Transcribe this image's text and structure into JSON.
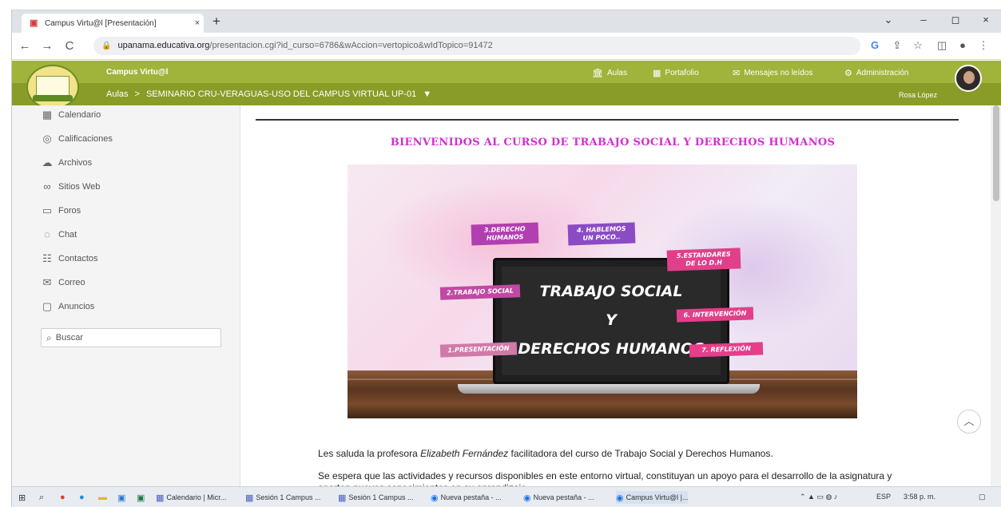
{
  "browser": {
    "tab_title": "Campus Virtu@l [Presentación]",
    "tab_close": "×",
    "new_tab": "+",
    "url_host": "upanama.educativa.org",
    "url_path": "/presentacion.cgi?id_curso=6786&wAccion=vertopico&wIdTopico=91472",
    "back": "←",
    "forward": "→",
    "reload": "C",
    "minimize": "–",
    "maximize": "◻",
    "close": "×",
    "chevron": "⌄"
  },
  "site": {
    "name": "Campus Virtu@l",
    "nav": [
      {
        "label": "Aulas",
        "icon": "building-icon"
      },
      {
        "label": "Portafolio",
        "icon": "portfolio-icon"
      },
      {
        "label": "Mensajes no leídos",
        "icon": "mail-icon"
      },
      {
        "label": "Administración",
        "icon": "gear-icon"
      }
    ],
    "breadcrumb_root": "Aulas",
    "breadcrumb_sep": ">",
    "breadcrumb_course": "SEMINARIO CRU-VERAGUAS-USO DEL CAMPUS VIRTUAL UP-01",
    "user": "Rosa López"
  },
  "sidebar": {
    "items": [
      {
        "label": "Calendario",
        "icon": "calendar-icon"
      },
      {
        "label": "Calificaciones",
        "icon": "check-circle-icon"
      },
      {
        "label": "Archivos",
        "icon": "cloud-icon"
      },
      {
        "label": "Sitios Web",
        "icon": "link-icon"
      },
      {
        "label": "Foros",
        "icon": "forum-icon"
      },
      {
        "label": "Chat",
        "icon": "chat-icon"
      },
      {
        "label": "Contactos",
        "icon": "contacts-icon"
      },
      {
        "label": "Correo",
        "icon": "mail-icon"
      },
      {
        "label": "Anuncios",
        "icon": "announcement-icon"
      }
    ],
    "search_placeholder": "Buscar"
  },
  "content": {
    "heading": "BIENVENIDOS AL CURSO DE TRABAJO SOCIAL Y DERECHOS HUMANOS",
    "banner": {
      "screen_line1": "TRABAJO SOCIAL",
      "screen_line2": "Y",
      "screen_line3": "DERECHOS HUMANOS",
      "tags": [
        {
          "label": "3.DERECHO HUMANOS",
          "color": "#b23fb0"
        },
        {
          "label": "4. HABLEMOS UN POCO..",
          "color": "#8a4bc4"
        },
        {
          "label": "5.ESTANDARES DE LO D.H",
          "color": "#e0408a"
        },
        {
          "label": "2.TRABAJO SOCIAL",
          "color": "#c04aa3"
        },
        {
          "label": "6. INTERVENCIÓN",
          "color": "#e0408a"
        },
        {
          "label": "1.PRESENTACIÓN",
          "color": "#d07aa8"
        },
        {
          "label": "7. REFLEXIÓN",
          "color": "#e83d8a"
        }
      ]
    },
    "para1_before": "Les saluda la profesora ",
    "para1_name": "Elizabeth Fernández",
    "para1_after": " facilitadora del curso de Trabajo Social y Derechos Humanos.",
    "para2": "Se espera que las actividades y recursos disponibles en este entorno virtual, constituyan un apoyo para el desarrollo de la asignatura y aporten nuevos conocimientos en su aprendizaje."
  },
  "taskbar": {
    "apps": [
      "Calendario | Micr...",
      "Sesión 1 Campus ...",
      "Sesión 1 Campus ...",
      "Nueva pestaña - ...",
      "Nueva pestaña - ...",
      "Campus Virtu@l |..."
    ],
    "lang": "ESP",
    "time": "3:58 p. m."
  }
}
